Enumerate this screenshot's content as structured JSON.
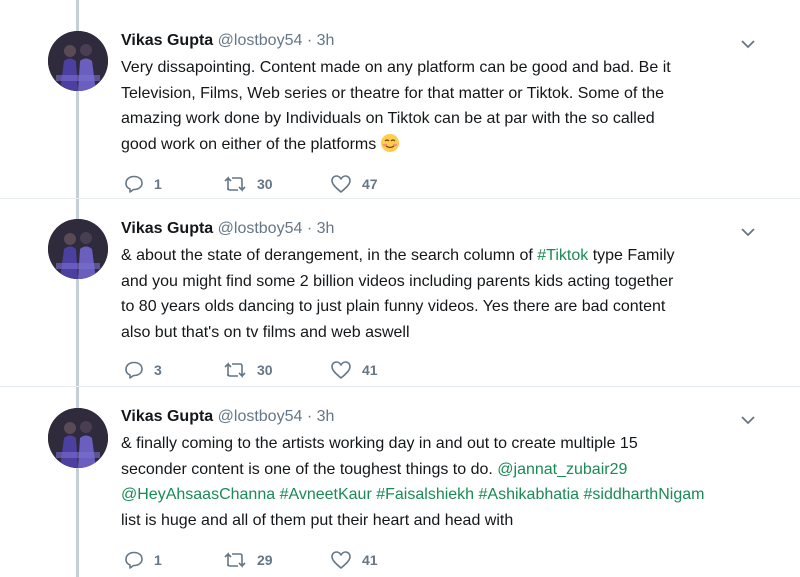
{
  "tweets": [
    {
      "author": "Vikas Gupta",
      "handle": "@lostboy54",
      "separator": "·",
      "time": "3h",
      "text_lines": [
        "Very dissapointing. Content made on any platform can be good and bad. Be it",
        "Television, Films, Web series or theatre for that matter or Tiktok. Some of the",
        "amazing work done by Individuals on Tiktok can be at par with the so called",
        "good work on either of the platforms"
      ],
      "emoji": "smiling-face-with-blush",
      "replies": "1",
      "retweets": "30",
      "likes": "47"
    },
    {
      "author": "Vikas Gupta",
      "handle": "@lostboy54",
      "separator": "·",
      "time": "3h",
      "line1_before": "& about the state of derangement, in the search column of ",
      "line1_hashtag": "#Tiktok",
      "line1_after": " type Family",
      "text_lines": [
        "and you might find some 2 billion videos including parents kids acting together",
        "to 80 years olds dancing to just plain funny videos. Yes there are bad content",
        "also but that's on tv films and web aswell"
      ],
      "replies": "3",
      "retweets": "30",
      "likes": "41"
    },
    {
      "author": "Vikas Gupta",
      "handle": "@lostboy54",
      "separator": "·",
      "time": "3h",
      "line1": "& finally coming to the artists working day in and out to create multiple 15",
      "line2_before": "seconder content is one of the toughest things to do. ",
      "line2_mention": "@jannat_zubair29",
      "line3_tags": [
        "@HeyAhsaasChanna",
        "#AvneetKaur",
        "#Faisalshiekh",
        "#Ashikabhatia",
        "#siddharthNigam"
      ],
      "line4": "list is huge and all of them put their heart and head with",
      "replies": "1",
      "retweets": "29",
      "likes": "41"
    }
  ],
  "icons": {
    "reply": "speech-bubble-icon",
    "retweet": "retweet-arrows-icon",
    "like": "heart-outline-icon",
    "menu": "chevron-down-icon"
  },
  "colors": {
    "link": "#1a8a56",
    "secondary_text": "#657786",
    "thread_line": "#c4cfd6"
  }
}
